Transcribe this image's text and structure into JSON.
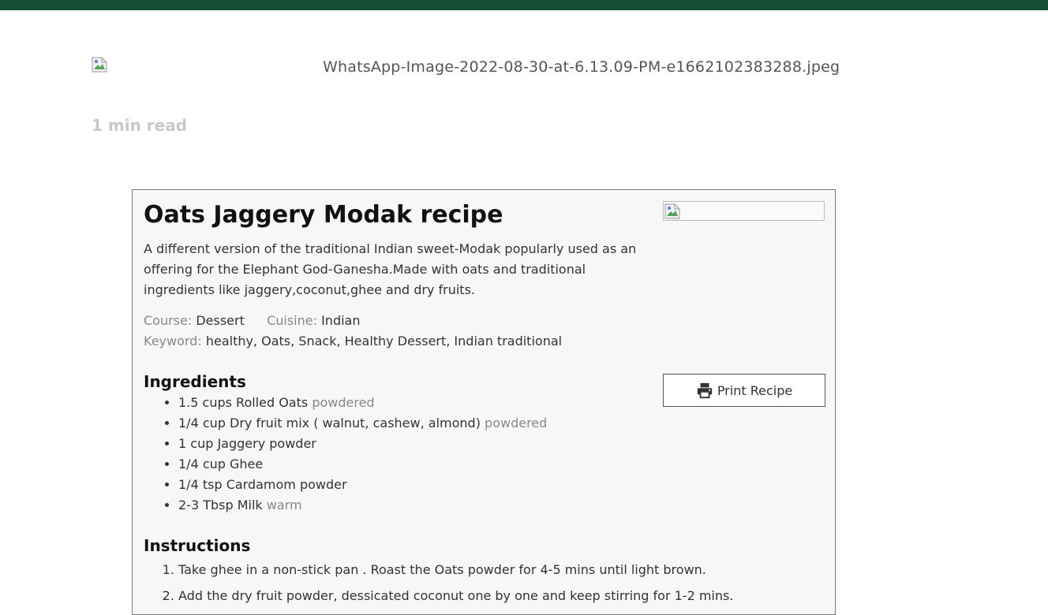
{
  "header": {
    "bar_color": "#134e33"
  },
  "featured_image": {
    "alt_text": "WhatsApp-Image-2022-08-30-at-6.13.09-PM-e1662102383288.jpeg"
  },
  "read_time": "1 min read",
  "recipe": {
    "title": "Oats Jaggery Modak recipe",
    "summary": "A different version of the traditional Indian sweet-Modak popularly used as an offering for the Elephant God-Ganesha.Made with oats and traditional ingredients like jaggery,coconut,ghee and dry fruits.",
    "course_label": "Course:",
    "course_value": "Dessert",
    "cuisine_label": "Cuisine:",
    "cuisine_value": "Indian",
    "keyword_label": "Keyword:",
    "keyword_value": "healthy, Oats, Snack, Healthy Dessert, Indian traditional",
    "print_label": "Print Recipe",
    "ingredients_heading": "Ingredients",
    "ingredients": [
      {
        "text": "1.5 cups Rolled Oats",
        "note": "powdered"
      },
      {
        "text": "1/4 cup Dry fruit mix ( walnut, cashew, almond)",
        "note": "powdered"
      },
      {
        "text": "1 cup Jaggery powder",
        "note": ""
      },
      {
        "text": "1/4 cup Ghee",
        "note": ""
      },
      {
        "text": "1/4 tsp Cardamom powder",
        "note": ""
      },
      {
        "text": "2-3 Tbsp Milk",
        "note": "warm"
      }
    ],
    "instructions_heading": "Instructions",
    "instructions": [
      "Take ghee in a non-stick pan . Roast the Oats powder for 4-5 mins until light brown.",
      "Add the dry fruit powder, dessicated coconut one by one and keep stirring for 1-2 mins."
    ]
  },
  "icons": {
    "broken_image": "broken-image-icon",
    "print": "printer-icon"
  }
}
